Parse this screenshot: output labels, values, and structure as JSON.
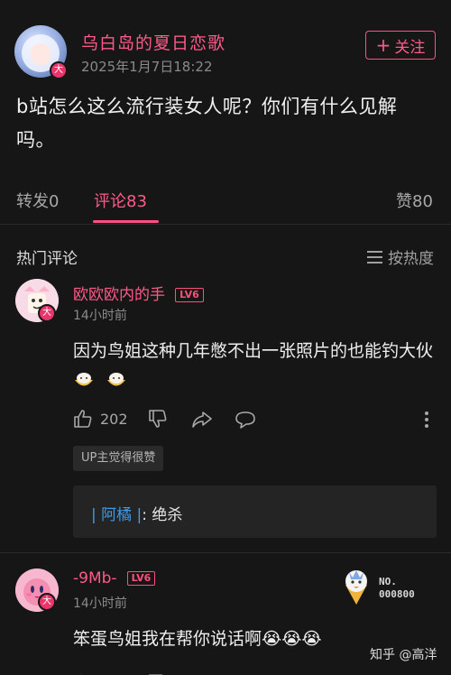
{
  "post": {
    "author": "乌白岛的夏日恋歌",
    "avatar_badge": "大",
    "time": "2025年1月7日18:22",
    "follow_label": "关注",
    "question": "b站怎么这么流行装女人呢？你们有什么见解吗。"
  },
  "tabs": {
    "repost": "转发0",
    "comment": "评论83",
    "like": "赞80"
  },
  "comments_section": {
    "title": "热门评论",
    "sort_label": "按热度"
  },
  "comments": [
    {
      "user": "欧欧欧内的手",
      "level": "LV6",
      "avatar_badge": "大",
      "time": "14小时前",
      "text": "因为鸟姐这种几年憋不出一张照片的也能钓大伙",
      "likes": "202",
      "up_liked": "UP主觉得很赞",
      "reply_user": "阿橘",
      "reply_text": ": 绝杀"
    },
    {
      "user": "-9Mb-",
      "level": "LV6",
      "avatar_badge": "大",
      "time": "14小时前",
      "text": "笨蛋鸟姐我在帮你说话啊😭😭😭",
      "no_badge_line1": "NO.",
      "no_badge_line2": "000800"
    }
  ],
  "watermark": "知乎 @高洋",
  "colors": {
    "accent": "#ff5a8a",
    "background": "#161616",
    "reply_name": "#3d9be9"
  }
}
